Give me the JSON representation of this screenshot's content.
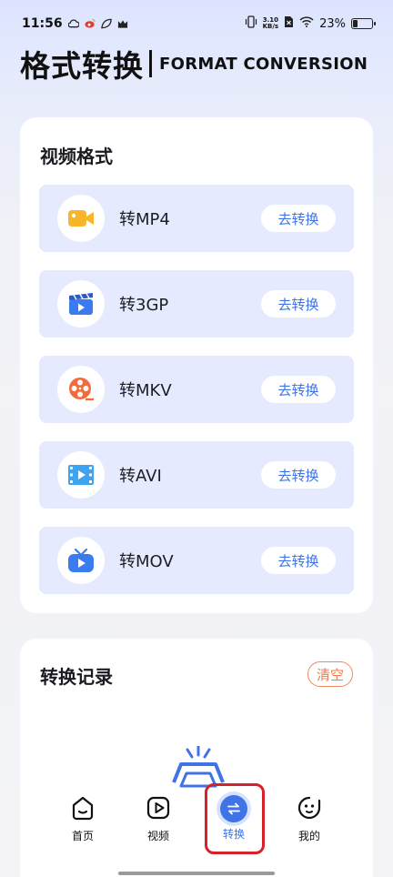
{
  "status_bar": {
    "time": "11:56",
    "net_speed_value": "3.10",
    "net_speed_unit": "KB/s",
    "battery_percent": "23%",
    "battery_level": 0.23
  },
  "header": {
    "title_cn": "格式转换",
    "title_en": "FORMAT CONVERSION"
  },
  "video_section": {
    "title": "视频格式",
    "items": [
      {
        "label": "转MP4",
        "button": "去转换",
        "icon": "video-camera-icon"
      },
      {
        "label": "转3GP",
        "button": "去转换",
        "icon": "clapperboard-icon"
      },
      {
        "label": "转MKV",
        "button": "去转换",
        "icon": "film-reel-icon"
      },
      {
        "label": "转AVI",
        "button": "去转换",
        "icon": "film-strip-icon"
      },
      {
        "label": "转MOV",
        "button": "去转换",
        "icon": "tv-play-icon"
      }
    ]
  },
  "record_section": {
    "title": "转换记录",
    "clear_label": "清空"
  },
  "tabbar": {
    "tabs": [
      {
        "label": "首页",
        "icon": "home-icon"
      },
      {
        "label": "视频",
        "icon": "play-icon"
      },
      {
        "label": "转换",
        "icon": "convert-icon"
      },
      {
        "label": "我的",
        "icon": "profile-icon"
      }
    ],
    "active_index": 2
  },
  "colors": {
    "accent": "#3f73e6",
    "row_bg": "#e5eafe",
    "clear": "#f07b4c",
    "highlight": "#d6202a"
  }
}
